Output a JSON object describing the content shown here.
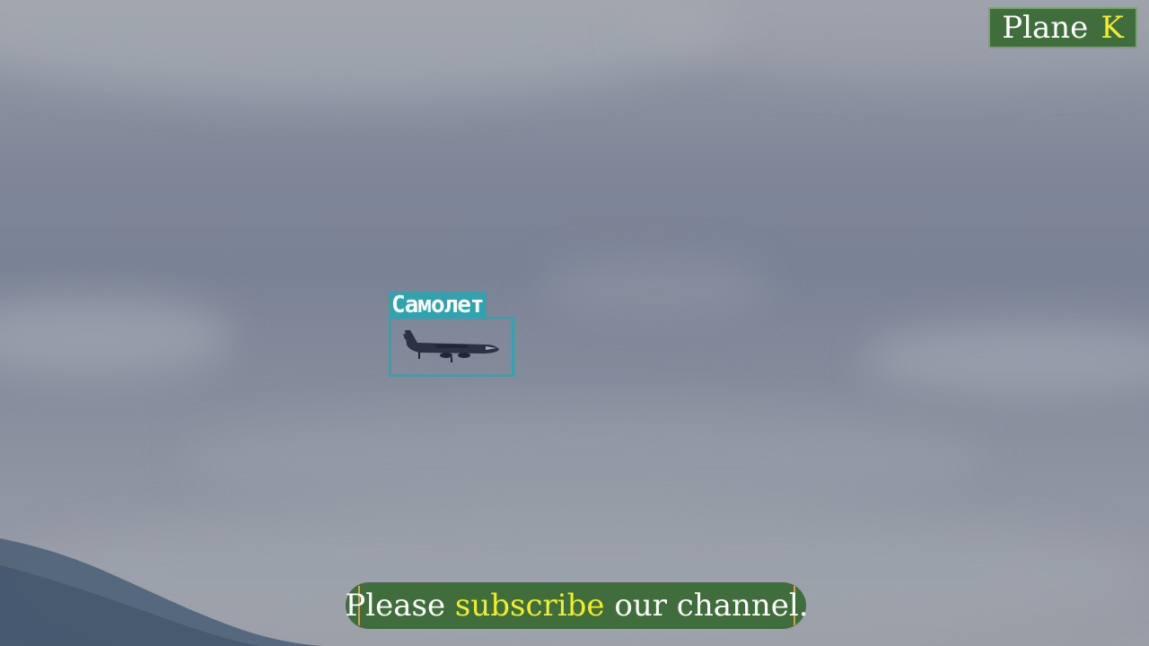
{
  "watermark": {
    "word": "Plane",
    "letter": "K",
    "letter_color": "#f3ec2a",
    "bg_color": "#3f6e3c"
  },
  "detection": {
    "label": "Самолет",
    "box_color": "#2fa3b0",
    "object_icon": "airplane-icon"
  },
  "banner": {
    "before": "Please",
    "highlight": "subscribe",
    "after": "our channel.",
    "highlight_color": "#f3ec2a",
    "bg_color": "#3f6e3c"
  }
}
